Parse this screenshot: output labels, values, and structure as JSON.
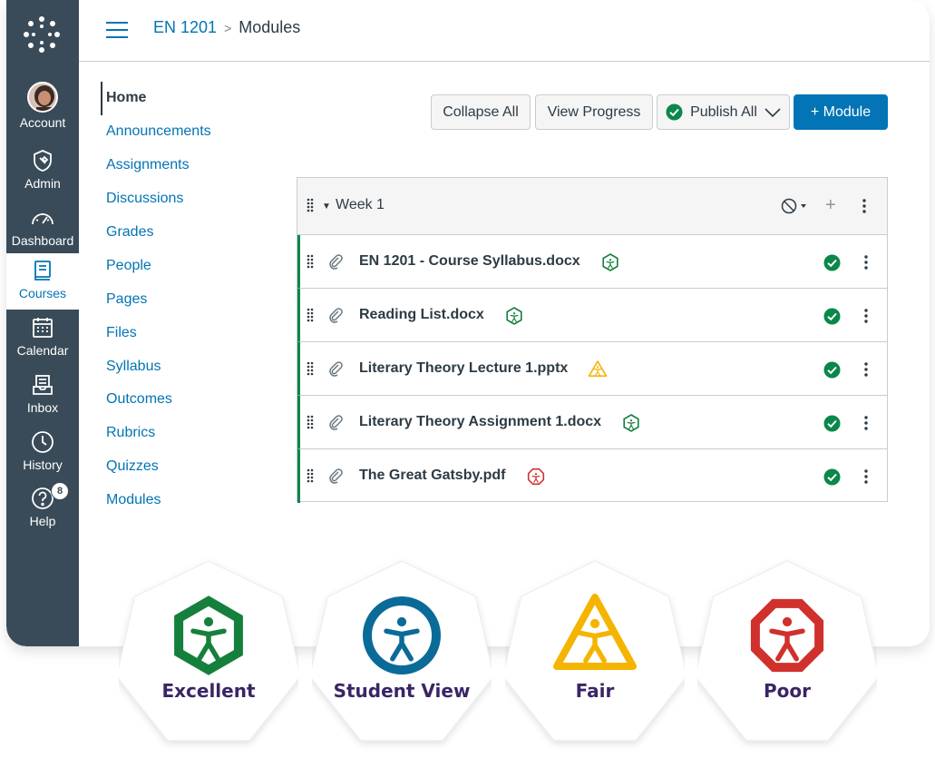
{
  "header": {
    "course_link": "EN 1201",
    "separator": ">",
    "current": "Modules"
  },
  "global_nav": {
    "items": [
      {
        "label": "Account",
        "icon": "avatar"
      },
      {
        "label": "Admin",
        "icon": "shield-wrench-icon"
      },
      {
        "label": "Dashboard",
        "icon": "speedometer-icon"
      },
      {
        "label": "Courses",
        "icon": "book-icon",
        "active": true
      },
      {
        "label": "Calendar",
        "icon": "calendar-icon"
      },
      {
        "label": "Inbox",
        "icon": "inbox-icon"
      },
      {
        "label": "History",
        "icon": "clock-icon"
      },
      {
        "label": "Help",
        "icon": "help-icon",
        "badge": "8"
      }
    ]
  },
  "course_nav": {
    "items": [
      "Home",
      "Announcements",
      "Assignments",
      "Discussions",
      "Grades",
      "People",
      "Pages",
      "Files",
      "Syllabus",
      "Outcomes",
      "Rubrics",
      "Quizzes",
      "Modules"
    ]
  },
  "toolbar": {
    "collapse_all": "Collapse All",
    "view_progress": "View Progress",
    "publish_all": "Publish All",
    "add_module": "+ Module"
  },
  "module": {
    "title": "Week 1",
    "items": [
      {
        "name": "EN 1201 - Course Syllabus.docx",
        "accessibility": "excellent"
      },
      {
        "name": "Reading List.docx",
        "accessibility": "excellent"
      },
      {
        "name": "Literary Theory Lecture 1.pptx",
        "accessibility": "fair"
      },
      {
        "name": "Literary Theory Assignment 1.docx",
        "accessibility": "excellent"
      },
      {
        "name": "The Great Gatsby.pdf",
        "accessibility": "poor"
      }
    ]
  },
  "legend": [
    {
      "label": "Excellent",
      "color": "#14803c",
      "shape": "hexagon"
    },
    {
      "label": "Student View",
      "color": "#0b6b98",
      "shape": "circle"
    },
    {
      "label": "Fair",
      "color": "#f5b400",
      "shape": "triangle"
    },
    {
      "label": "Poor",
      "color": "#d0312d",
      "shape": "octagon"
    }
  ],
  "colors": {
    "nav_bg": "#394b58",
    "link": "#0374b5",
    "published": "#0b874b"
  }
}
